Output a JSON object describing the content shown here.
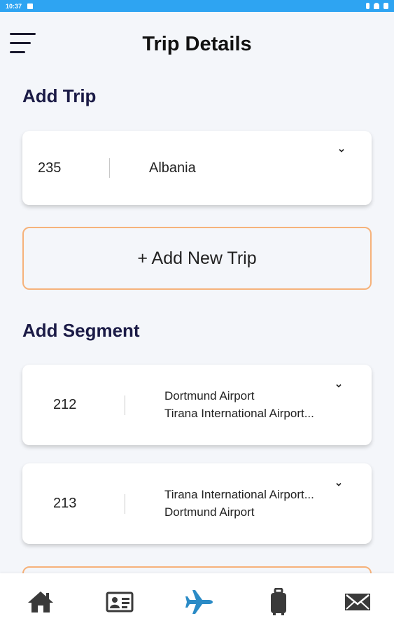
{
  "status_bar": {
    "time": "10:37"
  },
  "header": {
    "title": "Trip Details"
  },
  "add_trip": {
    "section_title": "Add Trip",
    "selected_trip": {
      "id": "235",
      "name": "Albania"
    },
    "add_button_label": "+ Add New Trip"
  },
  "add_segment": {
    "section_title": "Add Segment",
    "segments": [
      {
        "id": "212",
        "from": "Dortmund Airport",
        "to": "Tirana International Airport..."
      },
      {
        "id": "213",
        "from": "Tirana International Airport...",
        "to": "Dortmund Airport"
      }
    ]
  },
  "nav": {
    "items": [
      "home-icon",
      "id-card-icon",
      "airplane-icon",
      "luggage-icon",
      "mail-icon"
    ],
    "active": "airplane-icon"
  },
  "colors": {
    "status_bar": "#2ea4f2",
    "accent_border": "#f6b27a",
    "active_nav": "#2b8bc6",
    "inactive_nav": "#3a3a3a",
    "section_title": "#1b1b46"
  }
}
